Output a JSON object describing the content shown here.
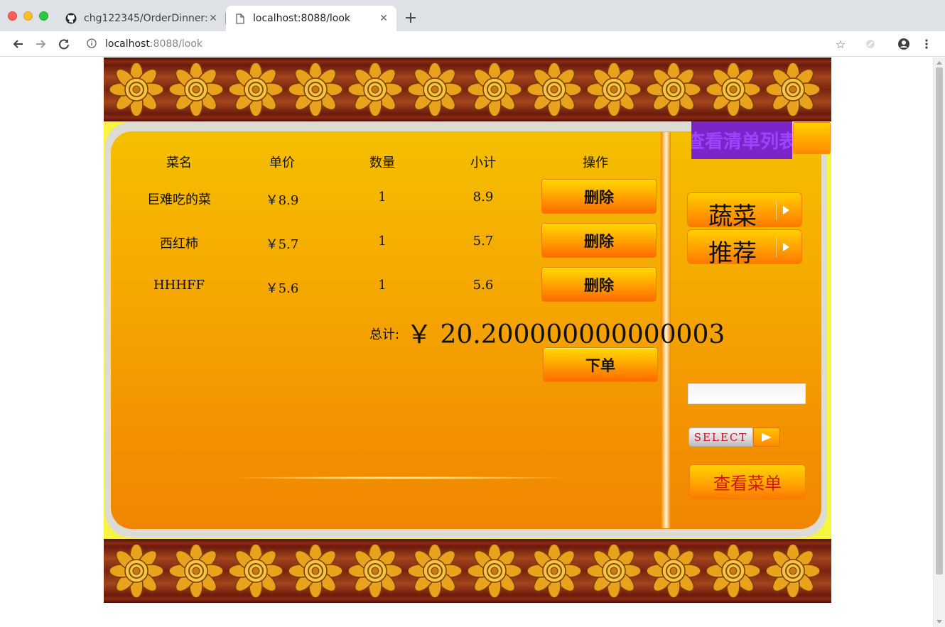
{
  "browser": {
    "tabs": [
      {
        "title": "chg122345/OrderDinner:",
        "icon": "github-icon",
        "active": false
      },
      {
        "title": "localhost:8088/look",
        "icon": "page-icon",
        "active": true
      }
    ],
    "url_host": "localhost",
    "url_path": ":8088/look"
  },
  "table": {
    "headers": [
      "菜名",
      "单价",
      "数量",
      "小计",
      "操作"
    ],
    "rows": [
      {
        "name": "巨难吃的菜",
        "price": "￥8.9",
        "qty": "1",
        "subtotal": "8.9",
        "action": "删除"
      },
      {
        "name": "西红柿",
        "price": "￥5.7",
        "qty": "1",
        "subtotal": "5.7",
        "action": "删除"
      },
      {
        "name": "HHHFF",
        "price": "￥5.6",
        "qty": "1",
        "subtotal": "5.6",
        "action": "删除"
      }
    ]
  },
  "total": {
    "label": "总计:",
    "value": "￥ 20.200000000000003"
  },
  "order_button": "下单",
  "sidebar": {
    "top_link": "查看清单列表",
    "menu": [
      {
        "label": "蔬菜"
      },
      {
        "label": "推荐"
      }
    ],
    "search_value": "",
    "select_label": "SELECT",
    "view_menu_label": "查看菜单"
  },
  "colors": {
    "panel_top": "#f5bf00",
    "panel_bottom": "#f08600",
    "frame_yellow": "#f7f542",
    "purple_link": "#7b24c8",
    "view_menu_text": "#d4141a"
  }
}
